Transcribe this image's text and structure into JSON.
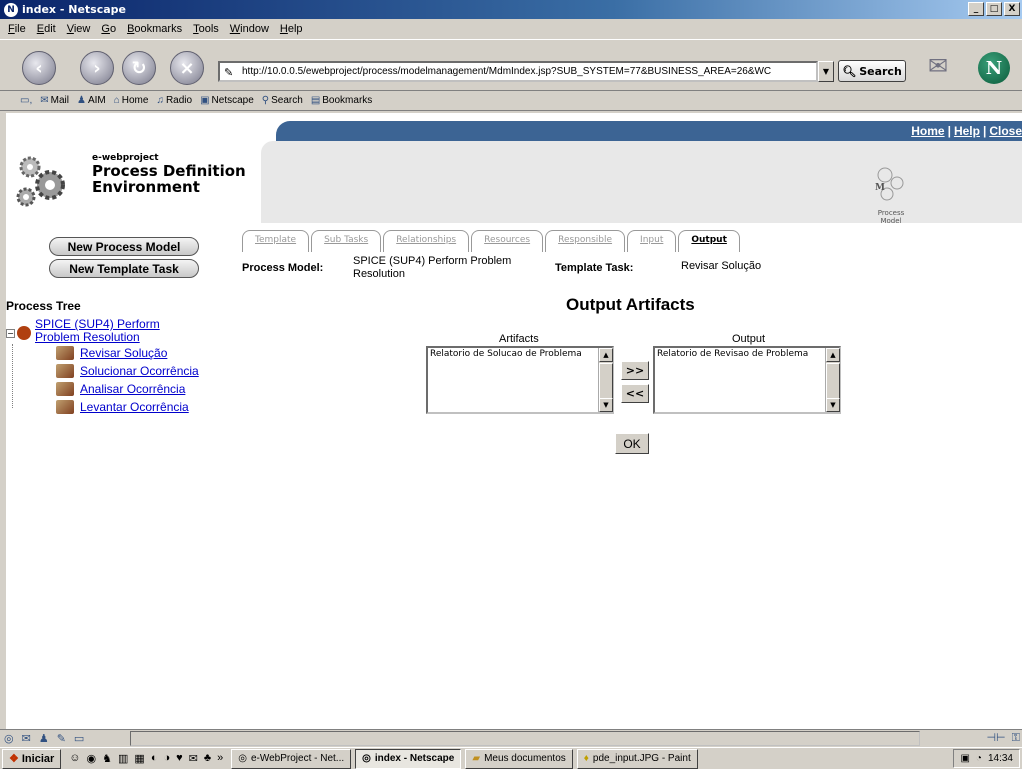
{
  "window": {
    "title": "index - Netscape",
    "controls": [
      "_",
      "□",
      "X"
    ]
  },
  "menu": [
    "File",
    "Edit",
    "View",
    "Go",
    "Bookmarks",
    "Tools",
    "Window",
    "Help"
  ],
  "nav": {
    "url": "http://10.0.0.5/ewebproject/process/modelmanagement/MdmIndex.jsp?SUB_SYSTEM=77&BUSINESS_AREA=26&WC",
    "search_label": "Search"
  },
  "personal_toolbar": [
    "Mail",
    "AIM",
    "Home",
    "Radio",
    "Netscape",
    "Search",
    "Bookmarks"
  ],
  "page": {
    "top_links": [
      "Home",
      "Help",
      "Close"
    ],
    "brand_small": "e-webproject",
    "brand_big_1": "Process Definition",
    "brand_big_2": "Environment",
    "logo_caption_1": "Process",
    "logo_caption_2": "Model",
    "tabs": [
      "Template",
      "Sub Tasks",
      "Relationships",
      "Resources",
      "Responsible",
      "Input",
      "Output"
    ],
    "active_tab": "Output",
    "buttons": {
      "new_process_model": "New Process Model",
      "new_template_task": "New Template Task"
    },
    "info": {
      "process_model_label": "Process Model:",
      "process_model_value_1": "SPICE (SUP4) Perform Problem",
      "process_model_value_2": "Resolution",
      "template_task_label": "Template Task:",
      "template_task_value": "Revisar Solução"
    },
    "tree": {
      "title": "Process Tree",
      "root_1": "SPICE (SUP4) Perform",
      "root_2": "Problem Resolution",
      "children": [
        "Revisar Solução",
        "Solucionar Ocorrência",
        "Analisar Ocorrência",
        "Levantar Ocorrência"
      ]
    },
    "output": {
      "title": "Output Artifacts",
      "artifacts_label": "Artifacts",
      "output_label": "Output",
      "artifacts_items": [
        "Relatorio de Solucao de Problema"
      ],
      "output_items": [
        "Relatorio de Revisao de Problema"
      ],
      "add_btn": ">>",
      "remove_btn": "<<",
      "ok_btn": "OK"
    }
  },
  "taskbar": {
    "start": "Iniciar",
    "overflow": "»",
    "tasks": [
      "e-WebProject - Net...",
      "index - Netscape",
      "Meus documentos",
      "pde_input.JPG - Paint"
    ],
    "active_task": "index - Netscape",
    "clock": "14:34"
  }
}
